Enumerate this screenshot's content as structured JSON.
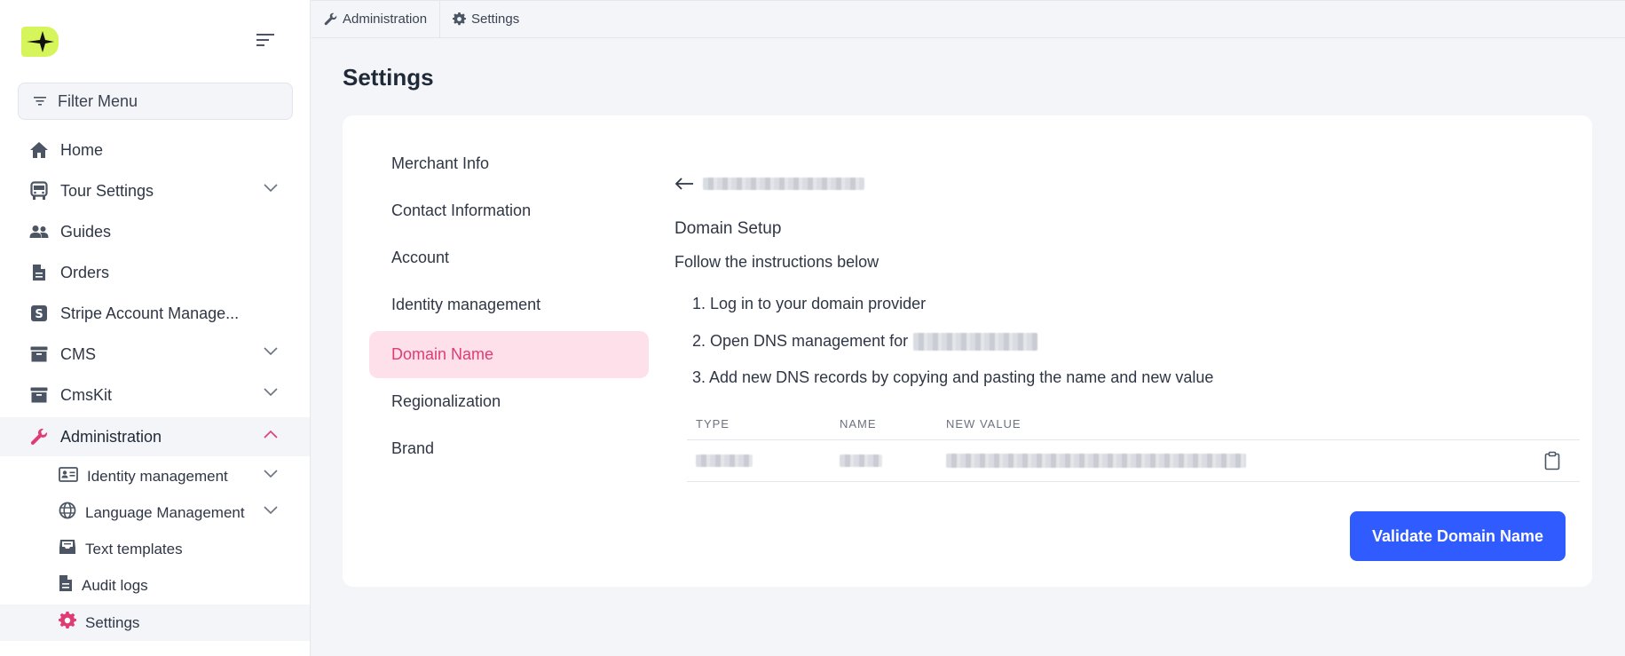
{
  "sidebar": {
    "logo_icon": "sparkle-logo",
    "filter": {
      "placeholder": "Filter Menu"
    },
    "items": [
      {
        "label": "Home",
        "icon": "home-icon"
      },
      {
        "label": "Tour Settings",
        "icon": "bus-icon"
      },
      {
        "label": "Guides",
        "icon": "users-icon"
      },
      {
        "label": "Orders",
        "icon": "document-icon"
      },
      {
        "label": "Stripe Account Manage...",
        "icon": "stripe-icon"
      },
      {
        "label": "CMS",
        "icon": "archive-icon"
      },
      {
        "label": "CmsKit",
        "icon": "archive-icon"
      },
      {
        "label": "Administration",
        "icon": "wrench-icon"
      }
    ],
    "sub_items": [
      {
        "label": "Identity management",
        "icon": "id-card-icon"
      },
      {
        "label": "Language Management",
        "icon": "globe-icon"
      },
      {
        "label": "Text templates",
        "icon": "inbox-icon"
      },
      {
        "label": "Audit logs",
        "icon": "file-icon"
      },
      {
        "label": "Settings",
        "icon": "gear-icon"
      }
    ]
  },
  "breadcrumb": {
    "items": [
      {
        "label": "Administration",
        "icon": "wrench-icon"
      },
      {
        "label": "Settings",
        "icon": "gear-icon"
      }
    ]
  },
  "page": {
    "title": "Settings"
  },
  "settings_nav": {
    "items": [
      "Merchant Info",
      "Contact Information",
      "Account",
      "Identity management",
      "Domain Name",
      "Regionalization",
      "Brand"
    ],
    "active": "Domain Name"
  },
  "domain_setup": {
    "title": "Domain Setup",
    "subtitle": "Follow the instructions below",
    "steps": [
      "1. Log in to your domain provider",
      "2. Open DNS management for",
      "3. Add new DNS records by copying and pasting the name and new value"
    ],
    "table": {
      "headers": [
        "TYPE",
        "NAME",
        "NEW VALUE"
      ]
    },
    "validate_label": "Validate Domain Name"
  },
  "colors": {
    "accent": "#2f5bff",
    "active_pink": "#e13b73",
    "active_pink_bg": "#fde0ea",
    "logo": "#d6f55a"
  }
}
